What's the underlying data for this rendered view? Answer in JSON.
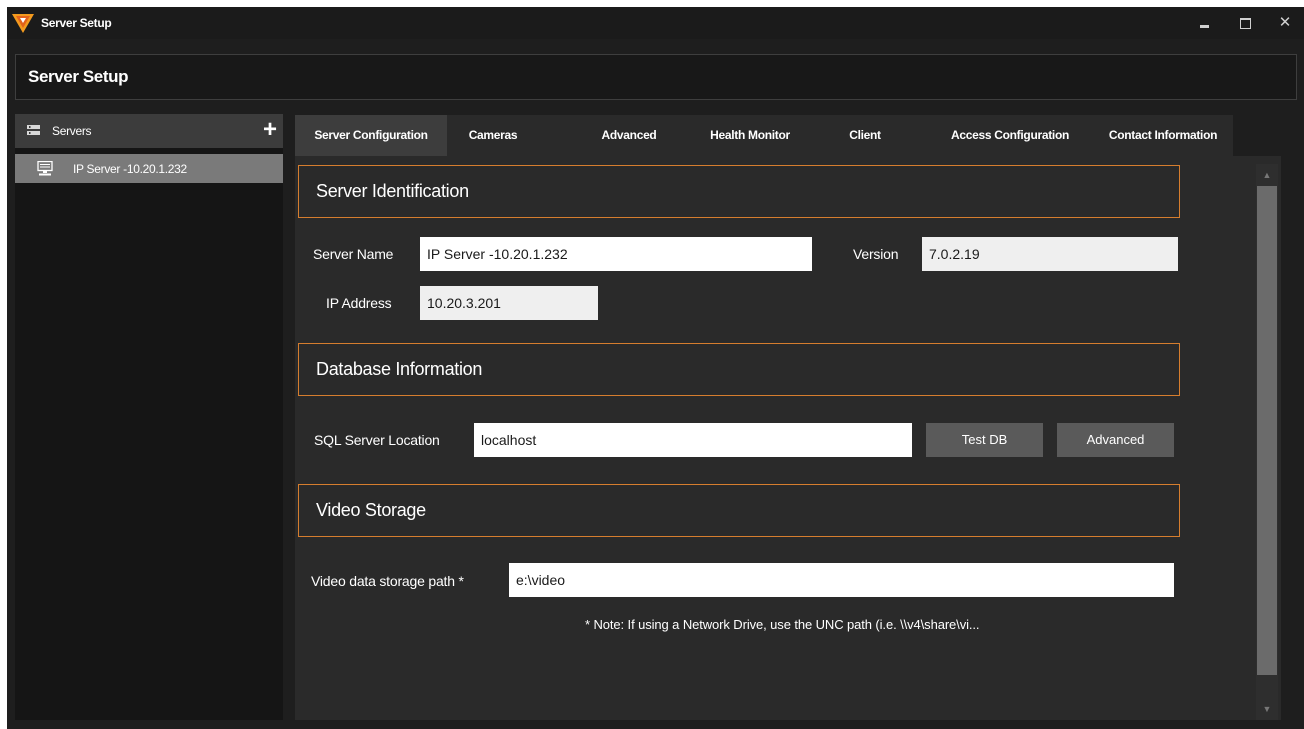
{
  "window": {
    "title": "Server Setup",
    "controls": {
      "minimize": "minimize-icon",
      "maximize": "maximize-icon",
      "close": "✕"
    }
  },
  "header": {
    "title": "Server Setup"
  },
  "sidebar": {
    "section_label": "Servers",
    "add_icon": "+",
    "items": [
      {
        "label": "IP Server -10.20.1.232",
        "selected": true
      }
    ]
  },
  "tabs": [
    {
      "label": "Server Configuration",
      "active": true
    },
    {
      "label": "Cameras"
    },
    {
      "label": "Advanced"
    },
    {
      "label": "Health Monitor"
    },
    {
      "label": "Client"
    },
    {
      "label": "Access Configuration"
    },
    {
      "label": "Contact Information"
    }
  ],
  "server_identification": {
    "title": "Server Identification",
    "server_name_label": "Server Name",
    "server_name_value": "IP Server -10.20.1.232",
    "version_label": "Version",
    "version_value": "7.0.2.19",
    "ip_label": "IP Address",
    "ip_value": "10.20.3.201"
  },
  "database": {
    "title": "Database Information",
    "sql_label": "SQL Server Location",
    "sql_value": "localhost",
    "test_button": "Test DB",
    "advanced_button": "Advanced"
  },
  "video_storage": {
    "title": "Video Storage",
    "path_label": "Video data storage path *",
    "path_value": "e:\\video",
    "note": "* Note: If using a Network Drive, use the UNC path (i.e. \\\\v4\\share\\vi..."
  },
  "colors": {
    "accent_border": "#d57d2e",
    "background": "#1e1e1e",
    "panel": "#2a2a2a",
    "selected_item": "#7a7a7a",
    "button": "#5a5a5a"
  }
}
